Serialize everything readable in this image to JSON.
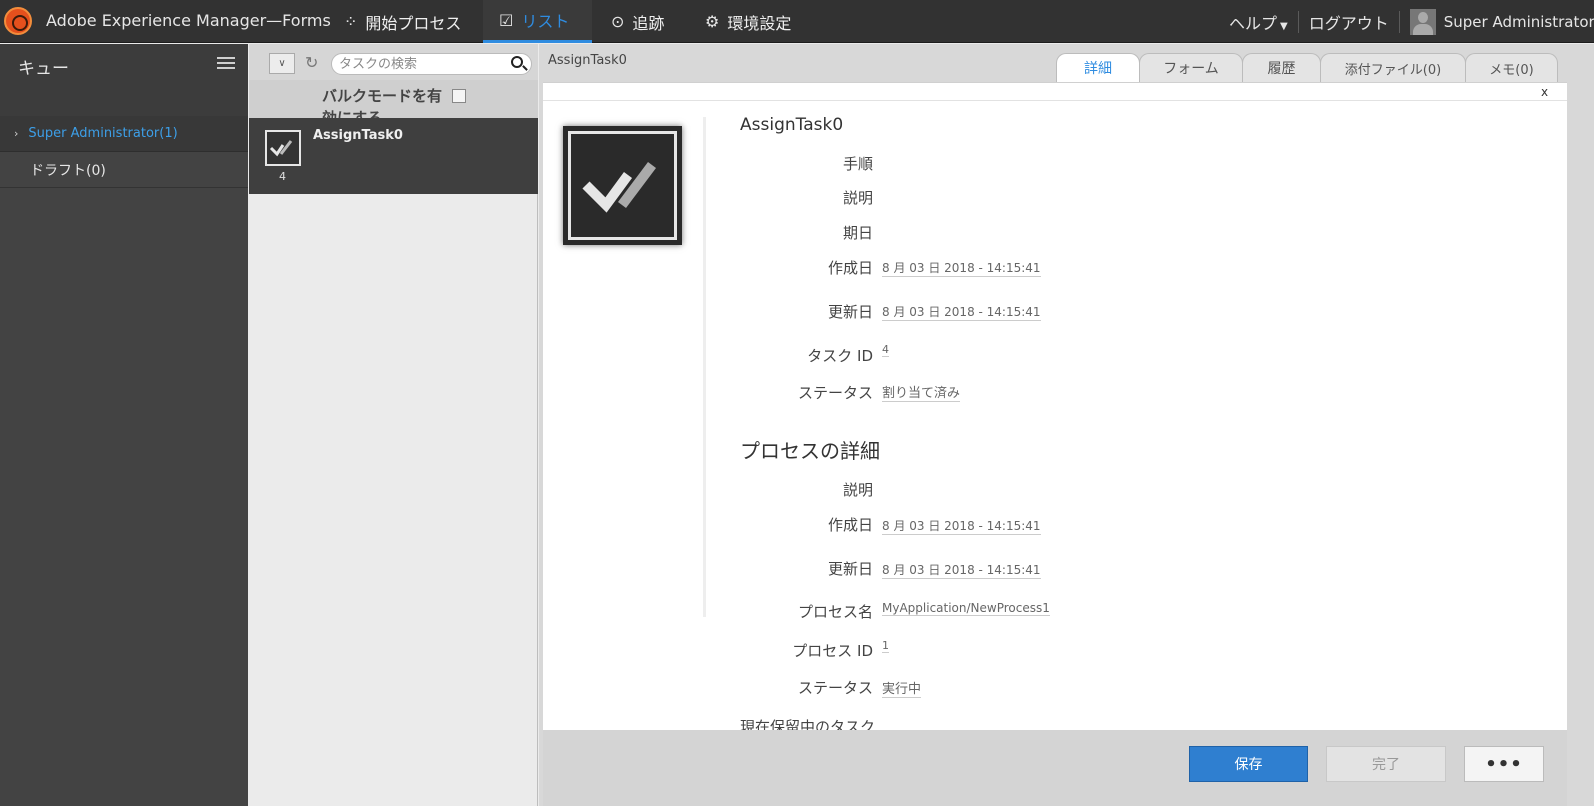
{
  "app": {
    "title": "Adobe Experience Manager—Forms"
  },
  "topnav": {
    "start_process": "開始プロセス",
    "list": "リスト",
    "tracking": "追跡",
    "settings": "環境設定",
    "help": "ヘルプ",
    "logout": "ログアウト",
    "user": "Super Administrator"
  },
  "sidebar": {
    "title": "キュー",
    "items": [
      {
        "label": "Super Administrator(1)"
      },
      {
        "label": "ドラフト(0)"
      }
    ]
  },
  "list": {
    "search_placeholder": "タスクの検索",
    "bulk_mode_label": "バルクモードを有効にする",
    "tasks": [
      {
        "name": "AssignTask0",
        "id": "4"
      }
    ]
  },
  "detail": {
    "header_title": "AssignTask0",
    "tabs": [
      "詳細",
      "フォーム",
      "履歴",
      "添付ファイル(0)",
      "メモ(0)"
    ],
    "close_label": "x",
    "task_title": "AssignTask0",
    "task_fields": {
      "instructions_label": "手順",
      "description_label": "説明",
      "deadline_label": "期日",
      "created_label": "作成日",
      "created_value": "8 月 03 日 2018 - 14:15:41",
      "updated_label": "更新日",
      "updated_value": "8 月 03 日 2018 - 14:15:41",
      "task_id_label": "タスク ID",
      "task_id_value": "4",
      "status_label": "ステータス",
      "status_value": "割り当て済み"
    },
    "process_title": "プロセスの詳細",
    "process_fields": {
      "description_label": "説明",
      "created_label": "作成日",
      "created_value": "8 月 03 日 2018 - 14:15:41",
      "updated_label": "更新日",
      "updated_value": "8 月 03 日 2018 - 14:15:41",
      "name_label": "プロセス名",
      "name_value": "MyApplication/NewProcess1",
      "id_label": "プロセス ID",
      "id_value": "1",
      "status_label": "ステータス",
      "status_value": "実行中"
    },
    "pending_tasks_label": "現在保留中のタスク"
  },
  "actions": {
    "save": "保存",
    "complete": "完了",
    "more": "•••"
  },
  "colors": {
    "accent": "#2f8ce0",
    "topbar": "#323232",
    "save_button": "#2f7fd0"
  }
}
